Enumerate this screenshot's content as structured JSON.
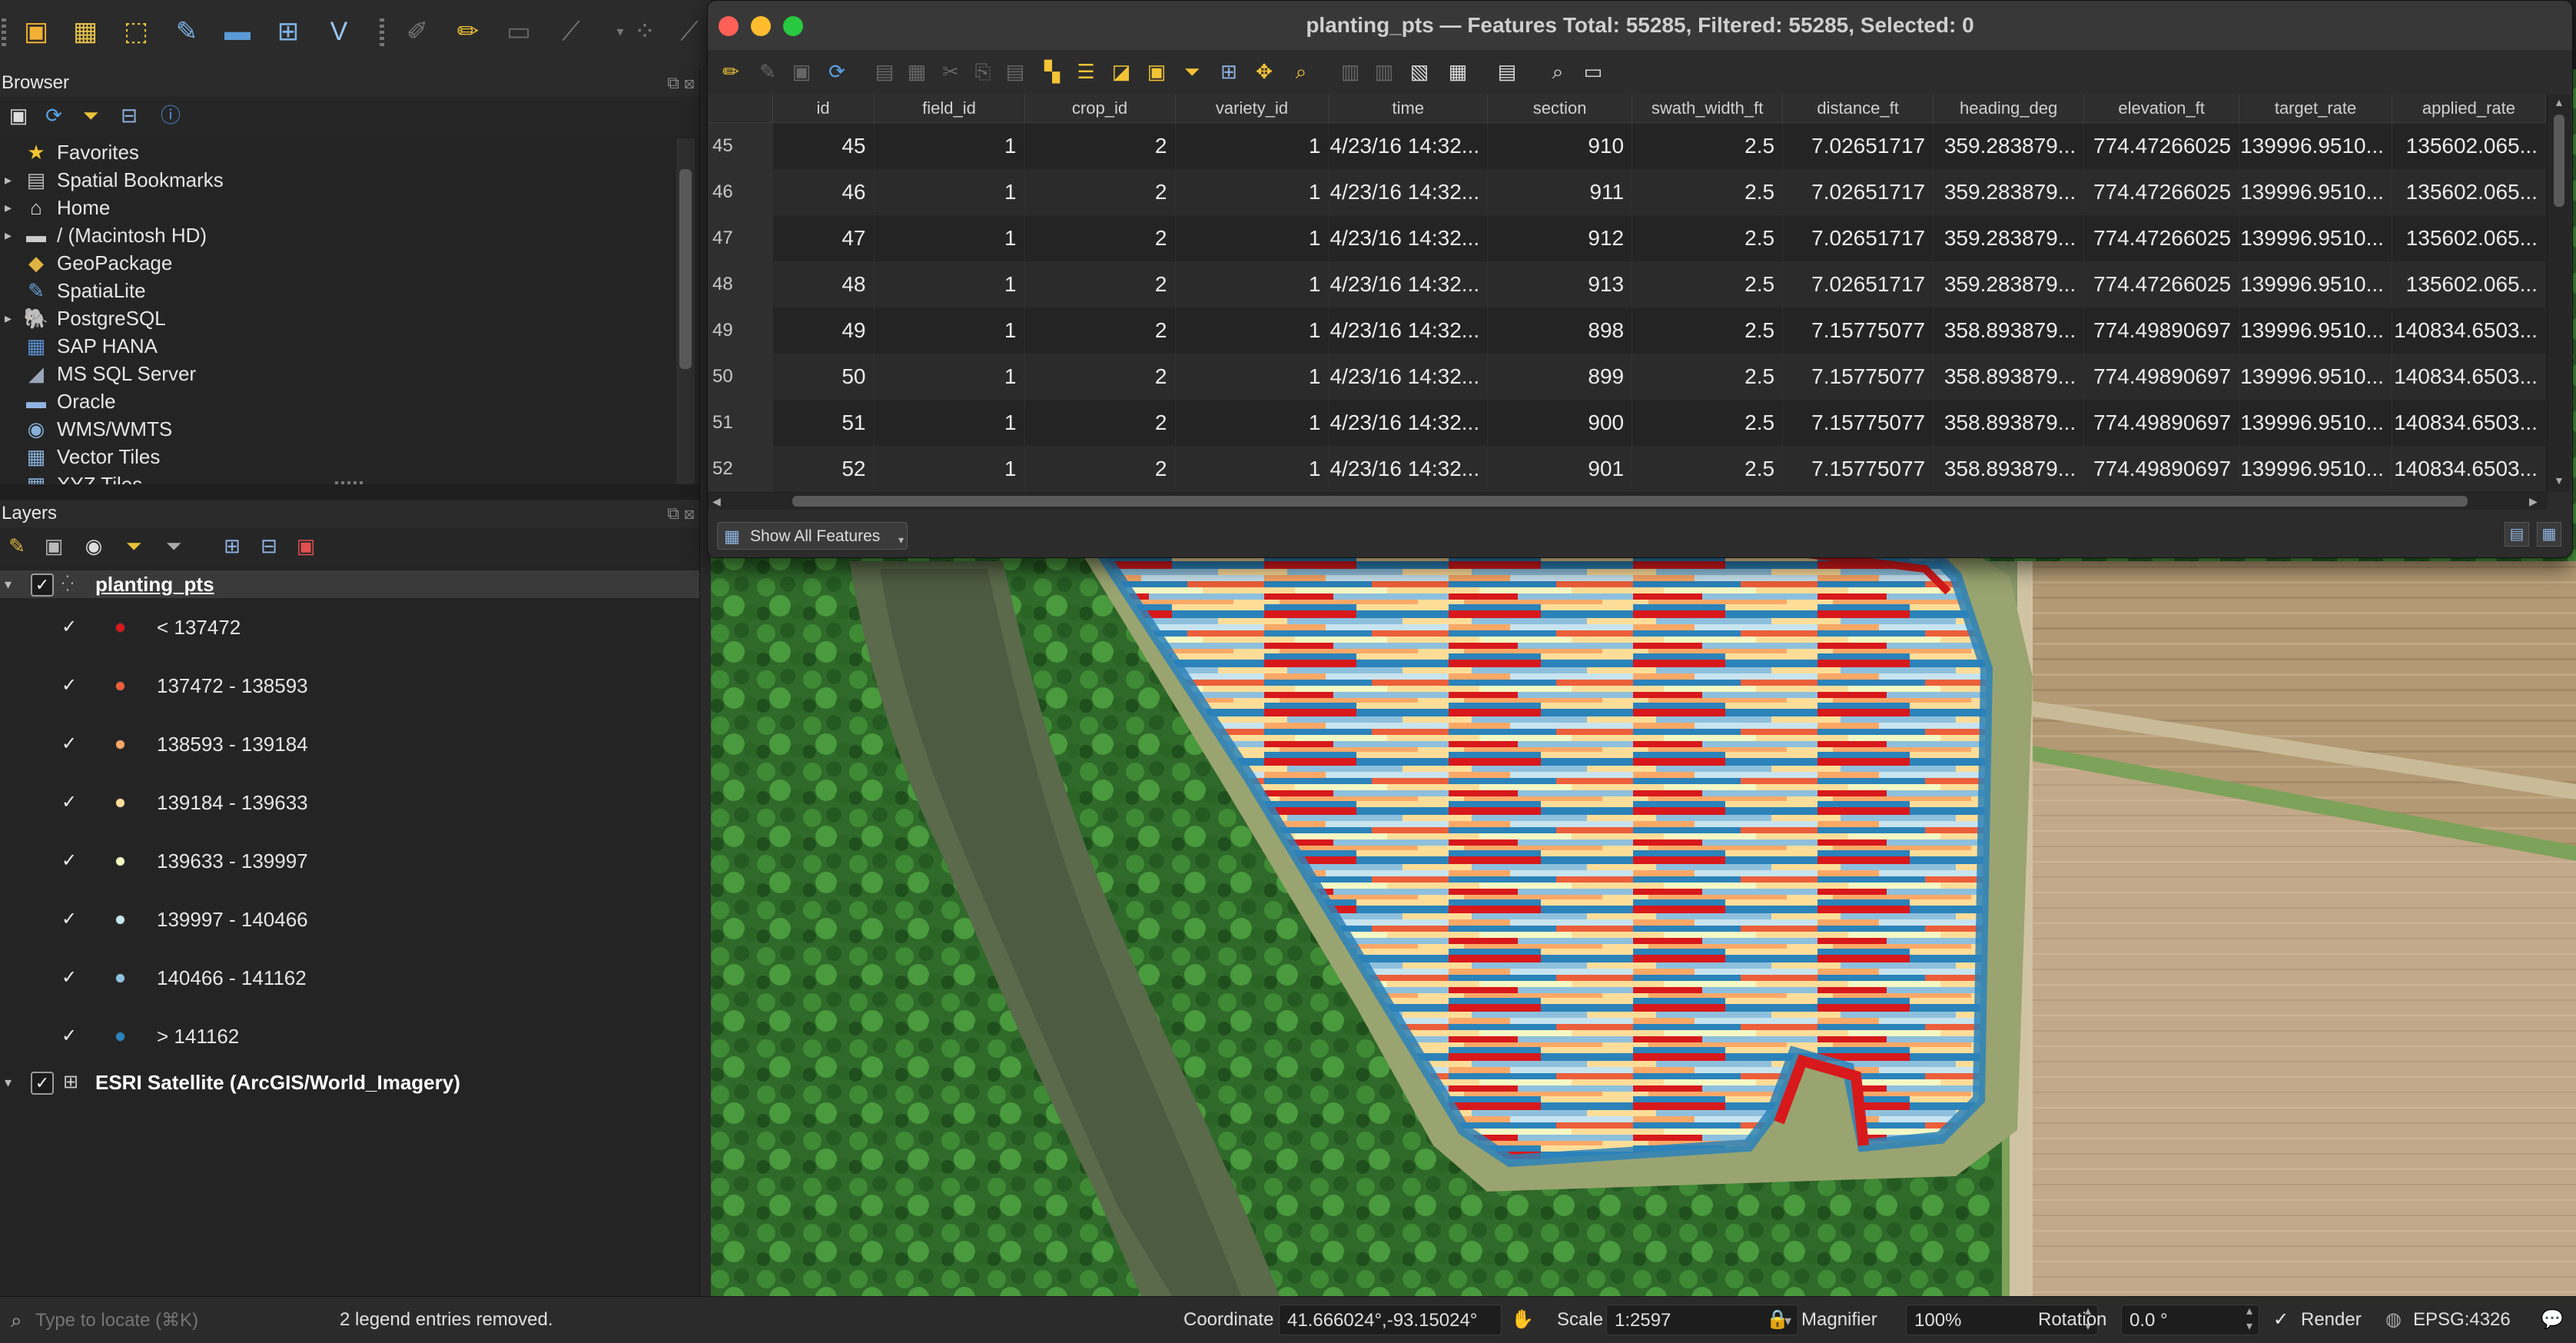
{
  "toolbar": {
    "icons": [
      "open-project-icon",
      "new-layer-icon",
      "select-icon",
      "digitize-icon",
      "add-layer-icon",
      "grid-icon",
      "vector-icon",
      "edit-icon",
      "pencil-icon",
      "save-edits-icon",
      "node-tool-icon",
      "snapping-icon",
      "more-icon"
    ]
  },
  "browser": {
    "title": "Browser",
    "items": [
      {
        "label": "Favorites",
        "icon": "★",
        "color": "#f3c531",
        "arrow": ""
      },
      {
        "label": "Spatial Bookmarks",
        "icon": "▤",
        "color": "#bbbbbb",
        "arrow": "▸"
      },
      {
        "label": "Home",
        "icon": "⌂",
        "color": "#dddddd",
        "arrow": "▸"
      },
      {
        "label": "/ (Macintosh HD)",
        "icon": "▬",
        "color": "#cccccc",
        "arrow": "▸"
      },
      {
        "label": "GeoPackage",
        "icon": "◆",
        "color": "#e0b341",
        "arrow": ""
      },
      {
        "label": "SpatiaLite",
        "icon": "✎",
        "color": "#6aa0d8",
        "arrow": ""
      },
      {
        "label": "PostgreSQL",
        "icon": "🐘",
        "color": "#6a8fc4",
        "arrow": "▸"
      },
      {
        "label": "SAP HANA",
        "icon": "▦",
        "color": "#5b8fd1",
        "arrow": ""
      },
      {
        "label": "MS SQL Server",
        "icon": "◢",
        "color": "#9aa6b8",
        "arrow": ""
      },
      {
        "label": "Oracle",
        "icon": "▬",
        "color": "#8fb4e2",
        "arrow": ""
      },
      {
        "label": "WMS/WMTS",
        "icon": "◉",
        "color": "#88b0d8",
        "arrow": ""
      },
      {
        "label": "Vector Tiles",
        "icon": "▦",
        "color": "#88b0d8",
        "arrow": ""
      },
      {
        "label": "XYZ Tiles",
        "icon": "▦",
        "color": "#88b0d8",
        "arrow": ""
      }
    ]
  },
  "layers": {
    "title": "Layers",
    "main_layer": "planting_pts",
    "legend": [
      {
        "label": "< 137472",
        "color": "#d7191c"
      },
      {
        "label": "137472 - 138593",
        "color": "#ec5f3b"
      },
      {
        "label": "138593 - 139184",
        "color": "#fba867"
      },
      {
        "label": "139184 - 139633",
        "color": "#fedd99"
      },
      {
        "label": "139633 - 139997",
        "color": "#f4f8c4"
      },
      {
        "label": "139997 - 140466",
        "color": "#c7e4ef"
      },
      {
        "label": "140466 - 141162",
        "color": "#8ec0dd"
      },
      {
        "label": "> 141162",
        "color": "#2b83ba"
      }
    ],
    "basemap": "ESRI Satellite (ArcGIS/World_Imagery)"
  },
  "attribute_table": {
    "title": "planting_pts — Features Total: 55285, Filtered: 55285, Selected: 0",
    "columns": [
      "id",
      "field_id",
      "crop_id",
      "variety_id",
      "time",
      "section",
      "swath_width_ft",
      "distance_ft",
      "heading_deg",
      "elevation_ft",
      "target_rate",
      "applied_rate"
    ],
    "rows": [
      [
        "45",
        "45",
        "1",
        "2",
        "1",
        "4/23/16 14:32...",
        "910",
        "2.5",
        "7.02651717",
        "359.283879...",
        "774.47266025",
        "139996.9510...",
        "135602.065..."
      ],
      [
        "46",
        "46",
        "1",
        "2",
        "1",
        "4/23/16 14:32...",
        "911",
        "2.5",
        "7.02651717",
        "359.283879...",
        "774.47266025",
        "139996.9510...",
        "135602.065..."
      ],
      [
        "47",
        "47",
        "1",
        "2",
        "1",
        "4/23/16 14:32...",
        "912",
        "2.5",
        "7.02651717",
        "359.283879...",
        "774.47266025",
        "139996.9510...",
        "135602.065..."
      ],
      [
        "48",
        "48",
        "1",
        "2",
        "1",
        "4/23/16 14:32...",
        "913",
        "2.5",
        "7.02651717",
        "359.283879...",
        "774.47266025",
        "139996.9510...",
        "135602.065..."
      ],
      [
        "49",
        "49",
        "1",
        "2",
        "1",
        "4/23/16 14:32...",
        "898",
        "2.5",
        "7.15775077",
        "358.893879...",
        "774.49890697",
        "139996.9510...",
        "140834.6503..."
      ],
      [
        "50",
        "50",
        "1",
        "2",
        "1",
        "4/23/16 14:32...",
        "899",
        "2.5",
        "7.15775077",
        "358.893879...",
        "774.49890697",
        "139996.9510...",
        "140834.6503..."
      ],
      [
        "51",
        "51",
        "1",
        "2",
        "1",
        "4/23/16 14:32...",
        "900",
        "2.5",
        "7.15775077",
        "358.893879...",
        "774.49890697",
        "139996.9510...",
        "140834.6503..."
      ],
      [
        "52",
        "52",
        "1",
        "2",
        "1",
        "4/23/16 14:32...",
        "901",
        "2.5",
        "7.15775077",
        "358.893879...",
        "774.49890697",
        "139996.9510...",
        "140834.6503..."
      ]
    ],
    "show_all_label": "Show All Features"
  },
  "status": {
    "locate_placeholder": "Type to locate (⌘K)",
    "message": "2 legend entries removed.",
    "coordinate_label": "Coordinate",
    "coordinate_value": "41.666024°,-93.15024°",
    "scale_label": "Scale",
    "scale_value": "1:2597",
    "magnifier_label": "Magnifier",
    "magnifier_value": "100%",
    "rotation_label": "Rotation",
    "rotation_value": "0.0 °",
    "render_label": "Render",
    "crs_label": "EPSG:4326"
  }
}
